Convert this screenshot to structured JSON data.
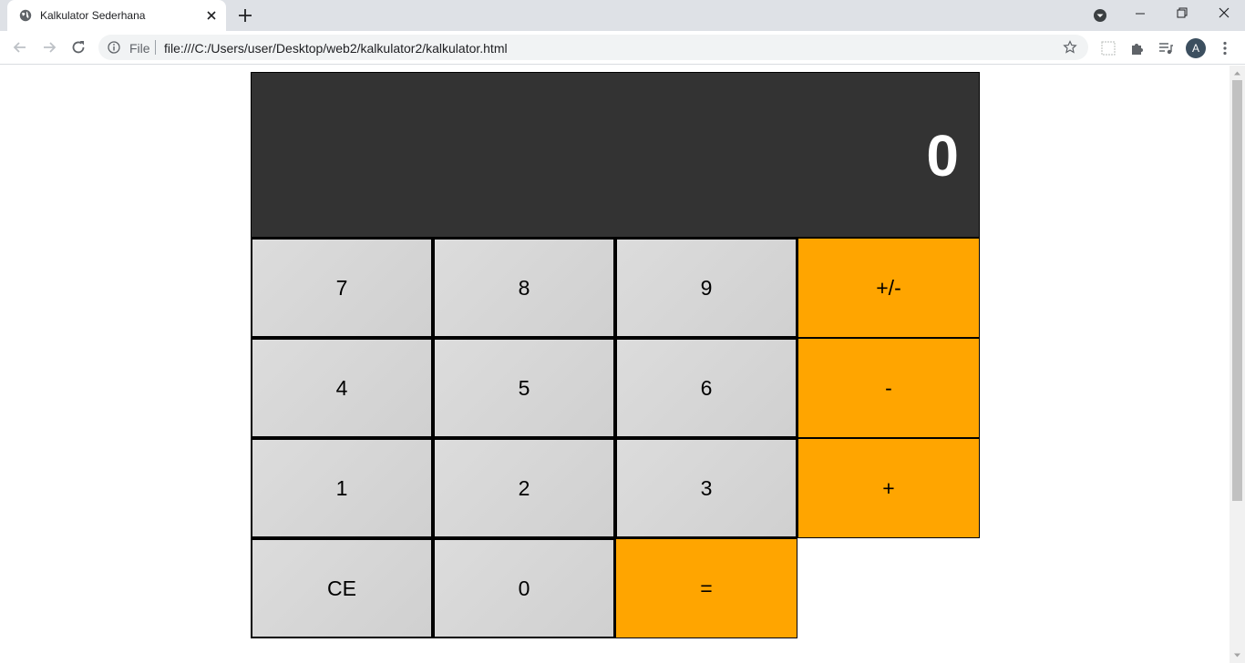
{
  "browser": {
    "tab_title": "Kalkulator Sederhana",
    "scheme_label": "File",
    "url": "file:///C:/Users/user/Desktop/web2/kalkulator2/kalkulator.html",
    "profile_initial": "A"
  },
  "calculator": {
    "display": "0",
    "keys": [
      "7",
      "8",
      "9",
      "+/-",
      "4",
      "5",
      "6",
      "-",
      "1",
      "2",
      "3",
      "+",
      "CE",
      "0",
      "="
    ]
  },
  "colors": {
    "display_bg": "#333333",
    "number_key_bg": "#d6d6d6",
    "operator_key_bg": "#ffa500"
  }
}
